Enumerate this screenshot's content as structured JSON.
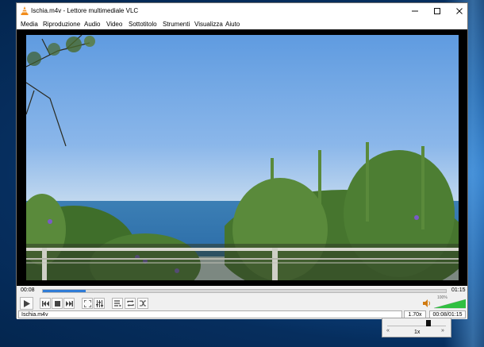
{
  "window": {
    "title": "Ischia.m4v - Lettore multimediale VLC"
  },
  "menu": [
    "Media",
    "Riproduzione",
    "Audio",
    "Video",
    "Sottotitolo",
    "Strumenti",
    "Visualizza",
    "Aiuto"
  ],
  "player": {
    "elapsed": "00:08",
    "total": "01:15",
    "progress_fraction": 0.107,
    "volume_label": "100%",
    "volume_fraction": 1.0
  },
  "status": {
    "filename": "Ischia.m4v",
    "speed": "1.70x",
    "time": "00:08/01:15"
  },
  "speed_popup": {
    "slower": "«",
    "faster": "»",
    "label": "1x"
  },
  "colors": {
    "accent": "#2e7bd6",
    "volume_green": "#30c040"
  }
}
